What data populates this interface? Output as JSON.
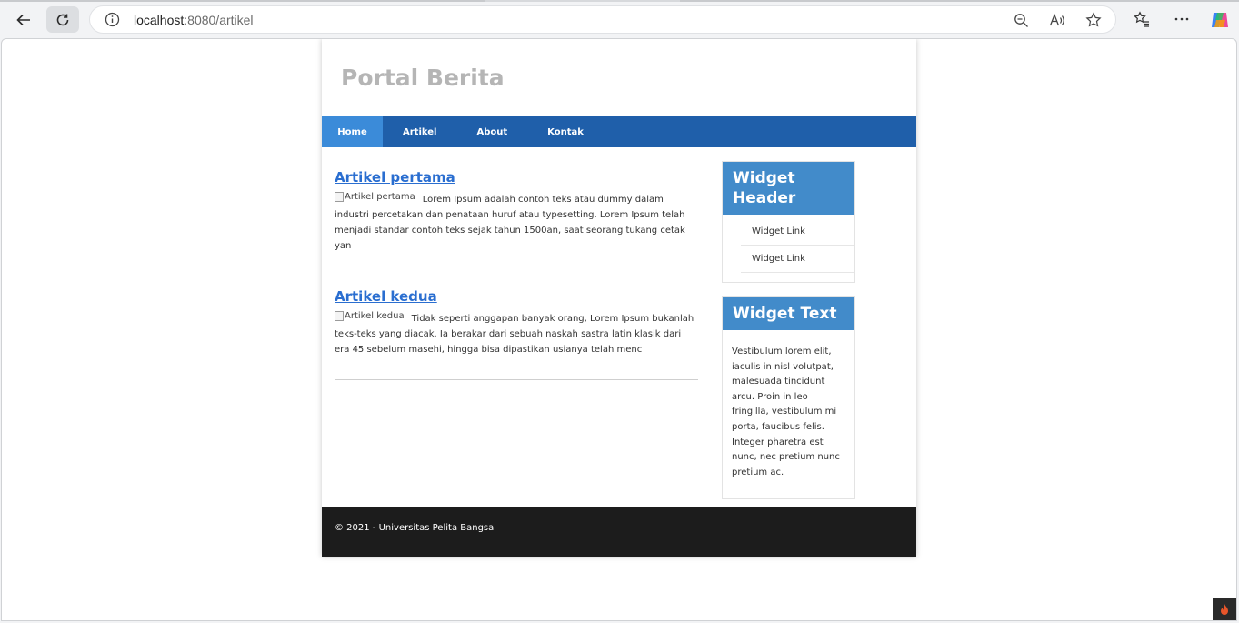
{
  "browser": {
    "url_host": "localhost",
    "url_rest": ":8080/artikel"
  },
  "site": {
    "title": "Portal Berita",
    "nav": [
      {
        "label": "Home",
        "active": true
      },
      {
        "label": "Artikel",
        "active": false
      },
      {
        "label": "About",
        "active": false
      },
      {
        "label": "Kontak",
        "active": false
      }
    ]
  },
  "articles": [
    {
      "title": "Artikel pertama",
      "image_alt": "Artikel pertama",
      "excerpt": "Lorem Ipsum adalah contoh teks atau dummy dalam industri percetakan dan penataan huruf atau typesetting. Lorem Ipsum telah menjadi standar contoh teks sejak tahun 1500an, saat seorang tukang cetak yan"
    },
    {
      "title": "Artikel kedua",
      "image_alt": "Artikel kedua",
      "excerpt": "Tidak seperti anggapan banyak orang, Lorem Ipsum bukanlah teks-teks yang diacak. Ia berakar dari sebuah naskah sastra latin klasik dari era 45 sebelum masehi, hingga bisa dipastikan usianya telah menc"
    }
  ],
  "sidebar": {
    "widget_header": {
      "title": "Widget Header",
      "links": [
        "Widget Link",
        "Widget Link"
      ]
    },
    "widget_text": {
      "title": "Widget Text",
      "body": "Vestibulum lorem elit, iaculis in nisl volutpat, malesuada tincidunt arcu. Proin in leo fringilla, vestibulum mi porta, faucibus felis. Integer pharetra est nunc, nec pretium nunc pretium ac."
    }
  },
  "footer": {
    "text": "© 2021 - Universitas Pelita Bangsa"
  },
  "colors": {
    "nav_bg": "#1f5faa",
    "nav_active": "#3b8bd9",
    "widget_head": "#428bca",
    "link": "#2a6ed0",
    "footer_bg": "#1c1c1c"
  }
}
